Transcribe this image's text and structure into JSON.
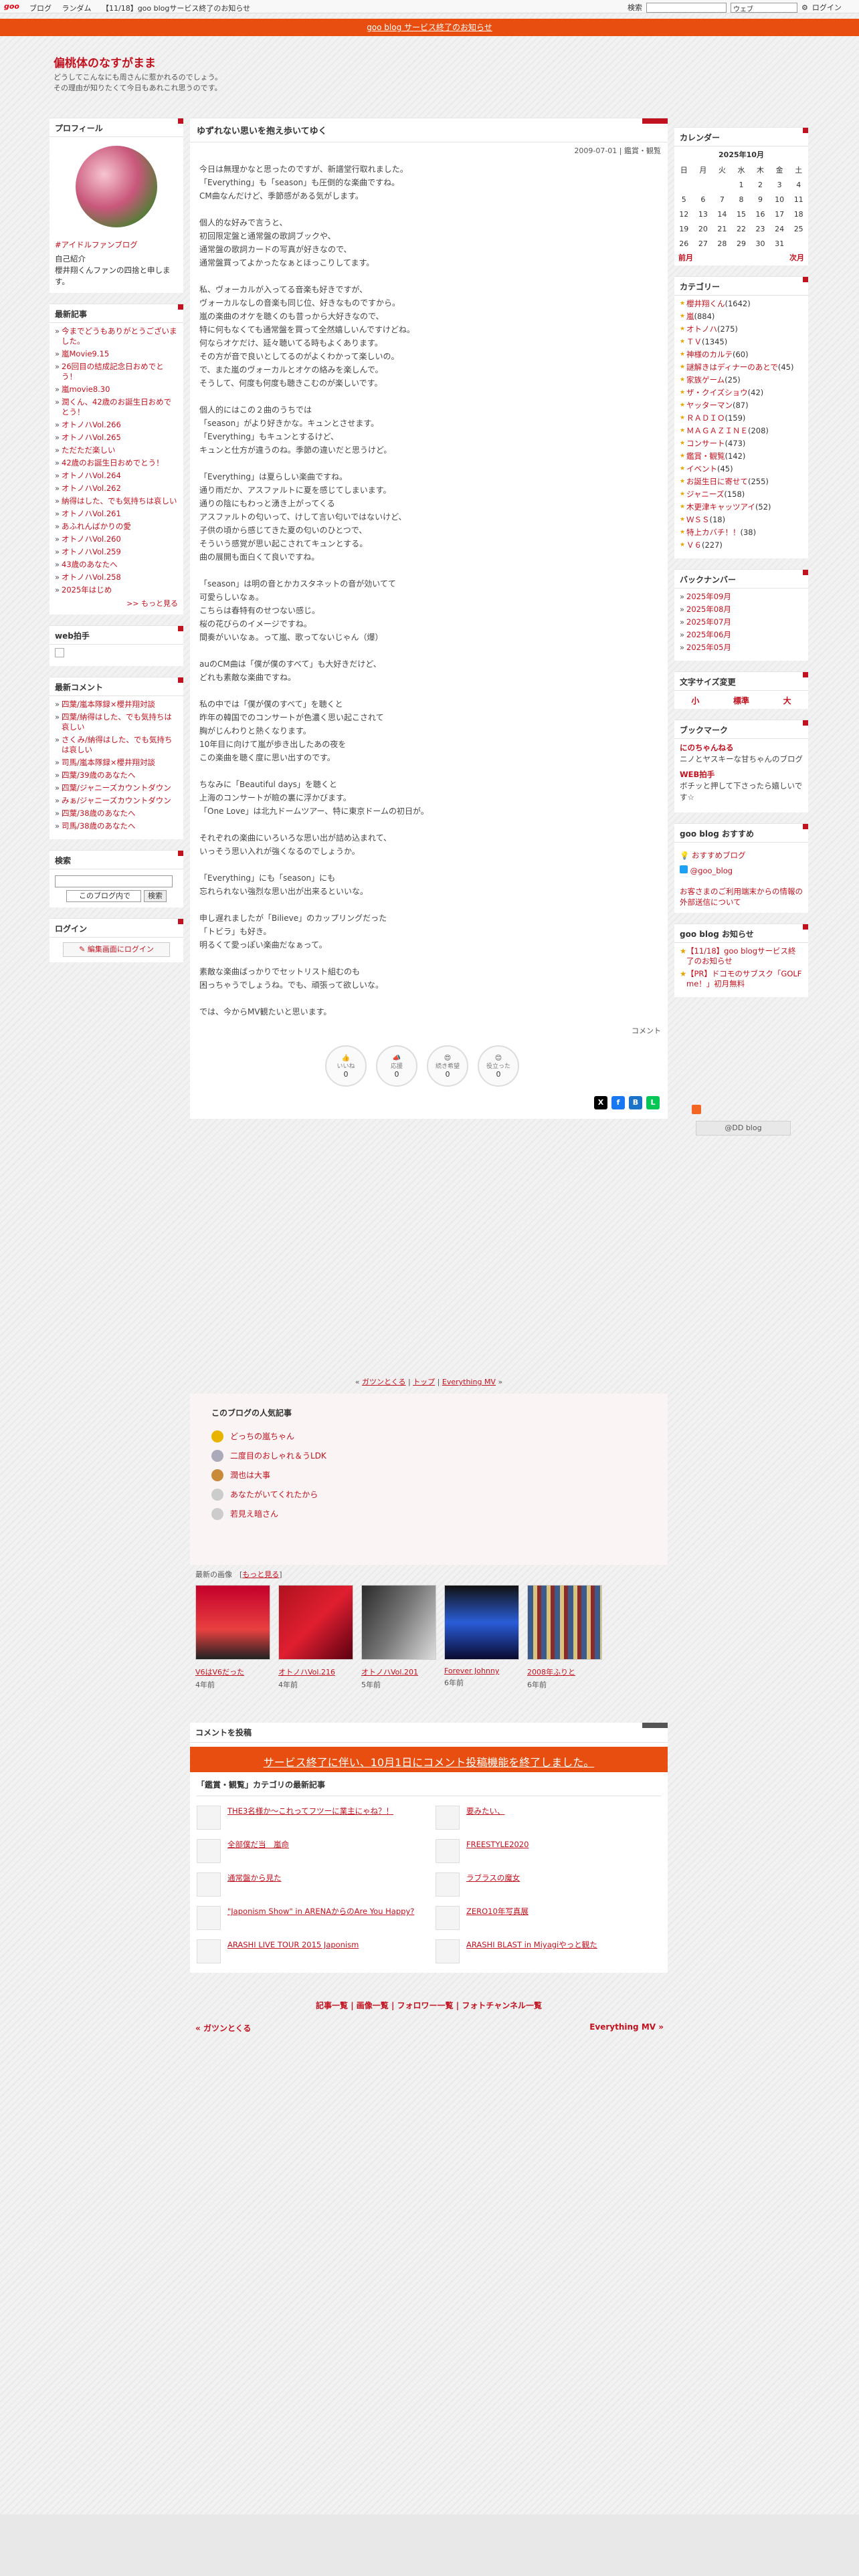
{
  "topbar": {
    "logo": "goo",
    "nav": [
      "ブログ",
      "ランダム",
      "【11/18】goo blogサービス終了のお知らせ"
    ],
    "search_label": "検索",
    "search_scope": "ウェブ",
    "login": "ログイン"
  },
  "notice": "goo blog サービス終了のお知らせ",
  "blog": {
    "title": "偏桃体のなすがまま",
    "desc": [
      "どうしてこんなにも周さんに惹かれるのでしょう。",
      "その理由が知りたくて今日もあれこれ思うのです。"
    ]
  },
  "profile": {
    "heading": "プロフィール",
    "tag": "#アイドルファンブログ",
    "intro_label": "自己紹介",
    "intro": "櫻井翔くんファンの四捨と申します。"
  },
  "recent": {
    "heading": "最新記事",
    "items": [
      "今までどうもありがとうございました。",
      "嵐Movie9.15",
      "26回目の結成記念日おめでとう！",
      "嵐movie8.30",
      "潤くん、42歳のお誕生日おめでとう！",
      "オトノハVol.266",
      "オトノハVol.265",
      "ただただ楽しい",
      "42歳のお誕生日おめでとう！",
      "オトノハVol.264",
      "オトノハVol.262",
      "納得はした、でも気持ちは哀しい",
      "オトノハVol.261",
      "あふれんばかりの愛",
      "オトノハVol.260",
      "オトノハVol.259",
      "43歳のあなたへ",
      "オトノハVol.258",
      "2025年はじめ"
    ],
    "more": ">> もっと見る"
  },
  "web": {
    "heading": "web拍手"
  },
  "comments": {
    "heading": "最新コメント",
    "items": [
      "四葉/嵐本隊録×櫻井翔対談",
      "四葉/納得はした、でも気持ちは哀しい",
      "さくみ/納得はした、でも気持ちは哀しい",
      "司馬/嵐本隊録×櫻井翔対談",
      "四葉/39歳のあなたへ",
      "四葉/ジャニーズカウントダウン",
      "みぁ/ジャニーズカウントダウン",
      "四葉/38歳のあなたへ",
      "司馬/38歳のあなたへ"
    ]
  },
  "search": {
    "heading": "検索",
    "scope": "このブログ内で",
    "button": "検索"
  },
  "login": {
    "heading": "ログイン",
    "button": "編集画面にログイン"
  },
  "article": {
    "title": "ゆずれない思いを抱え歩いてゆく",
    "date": "2009-07-01",
    "category": "鑑賞・観覧",
    "body": "今日は無理かなと思ったのですが、新譜堂行取れました。\n「Everything」も「season」も圧倒的な楽曲ですね。\nCM曲なんだけど、季節感がある気がします。\n\n個人的な好みで言うと、\n初回限定盤と通常盤の歌詞ブックや、\n通常盤の歌詞カードの写真が好きなので、\n通常盤買ってよかったなぁとほっこりしてます。\n\n私、ヴォーカルが入ってる音楽も好きですが、\nヴォーカルなしの音楽も同じ位、好きなものですから。\n嵐の楽曲のオケを聴くのも昔っから大好きなので、\n特に何もなくても通常盤を買って全然嬉しいんですけどね。\n何ならオケだけ、延々聴いてる時もよくあります。\nその方が音で良いとしてるのがよくわかって楽しいの。\nで、また嵐のヴォーカルとオケの絡みを楽しんで。\nそうして、何度も何度も聴きこむのが楽しいです。\n\n個人的にはこの２曲のうちでは\n「season」がより好きかな。キュンとさせます。\n「Everything」もキュンとするけど、\nキュンと仕方が違うのね。季節の違いだと思うけど。\n\n「Everything」は夏らしい楽曲ですね。\n通り雨だか、アスファルトに夏を感じてしまいます。\n通りの陰にもわっと湧き上がってくる\nアスファルトの匂いって、けして言い匂いではないけど、\n子供の頃から感じてきた夏の匂いのひとつで、\nそういう感覚が思い起こされてキュンとする。\n曲の展開も面白くて良いですね。\n\n「season」は明の音とかカスタネットの音が効いてて\n可愛らしいなぁ。\nこちらは春特有のせつない感じ。\n桜の花びらのイメージですね。\n間奏がいいなぁ。って嵐、歌ってないじゃん（爆）\n\nauのCM曲は「僕が僕のすべて」も大好きだけど、\nどれも素敵な楽曲ですね。\n\n私の中では「僕が僕のすべて」を聴くと\n昨年の韓国でのコンサートが色濃く思い起こされて\n胸がじんわりと熱くなります。\n10年目に向けて嵐が歩き出したあの夜を\nこの楽曲を聴く度に思い出すのです。\n\nちなみに「Beautiful days」を聴くと\n上海のコンサートが瞼の裏に浮かびます。\n「One Love」は北九ドームツアー、特に東京ドームの初日が。\n\nそれぞれの楽曲にいろいろな思い出が詰め込まれて、\nいっそう思い入れが強くなるのでしょうか。\n\n「Everything」にも「season」にも\n忘れられない強烈な思い出が出来るといいな。\n\n申し遅れましたが「Bilieve」のカップリングだった\n「トビラ」も好き。\n明るくて愛っぽい楽曲だなぁって。\n\n素敵な楽曲ばっかりでセットリスト組むのも\n困っちゃうでしょうね。でも、頑張って欲しいな。\n\nでは、今からMV観たいと思います。",
    "comment_link": "コメント",
    "reactions": [
      {
        "label": "いいね",
        "count": "0"
      },
      {
        "label": "応援",
        "count": "0"
      },
      {
        "label": "続き希望",
        "count": "0"
      },
      {
        "label": "役立った",
        "count": "0"
      }
    ]
  },
  "pager": {
    "prev": "ガツンとくる",
    "top": "トップ",
    "next": "Everything MV"
  },
  "popular": {
    "heading": "このブログの人気記事",
    "items": [
      "どっちの嵐ちゃん",
      "二度目のおしゃれ＆うLDK",
      "潤也は大事",
      "あなたがいてくれたから",
      "若見え暗さん"
    ]
  },
  "images": {
    "heading": "最新の画像",
    "more": "もっと見る",
    "items": [
      {
        "cap": "V6はV6だった",
        "ago": "4年前"
      },
      {
        "cap": "オトノハVol.216",
        "ago": "4年前"
      },
      {
        "cap": "オトノハVol.201",
        "ago": "5年前"
      },
      {
        "cap": "Forever Johnny",
        "ago": "6年前"
      },
      {
        "cap": "2008年ふりと",
        "ago": "6年前"
      }
    ]
  },
  "post_comment": {
    "heading": "コメントを投稿",
    "banner": "サービス終了に伴い、10月1日にコメント投稿機能を終了しました。"
  },
  "category_latest": {
    "heading": "「鑑賞・観覧」カテゴリの最新記事",
    "items": [
      "THE3名様か〜これってフツーに業主にゃね？！",
      "要みたい、",
      "全部僕だ当　嵐命",
      "FREESTYLE2020",
      "通常盤から見た",
      "ラブラスの魔女",
      "\"Japonism Show\" in ARENAからのAre You Happy?",
      "ZERO10年写真展",
      "ARASHI LIVE TOUR 2015 Japonism",
      "ARASHI BLAST in Miyagiやっと観た"
    ]
  },
  "footer": {
    "links": [
      "記事一覧",
      "画像一覧",
      "フォロワー一覧",
      "フォトチャンネル一覧"
    ],
    "prev": "ガツンとくる",
    "next": "Everything MV"
  },
  "calendar": {
    "heading": "カレンダー",
    "month": "2025年10月",
    "dows": [
      "日",
      "月",
      "火",
      "水",
      "木",
      "金",
      "土"
    ],
    "weeks": [
      [
        "",
        "",
        "",
        "1",
        "2",
        "3",
        "4"
      ],
      [
        "5",
        "6",
        "7",
        "8",
        "9",
        "10",
        "11"
      ],
      [
        "12",
        "13",
        "14",
        "15",
        "16",
        "17",
        "18"
      ],
      [
        "19",
        "20",
        "21",
        "22",
        "23",
        "24",
        "25"
      ],
      [
        "26",
        "27",
        "28",
        "29",
        "30",
        "31",
        ""
      ]
    ],
    "prev": "前月",
    "next": "次月"
  },
  "categories": {
    "heading": "カテゴリー",
    "items": [
      {
        "n": "櫻井翔くん",
        "c": "(1642)"
      },
      {
        "n": "嵐",
        "c": "(884)"
      },
      {
        "n": "オトノハ",
        "c": "(275)"
      },
      {
        "n": "ＴＶ",
        "c": "(1345)"
      },
      {
        "n": "神様のカルテ",
        "c": "(60)"
      },
      {
        "n": "謎解きはディナーのあとで",
        "c": "(45)"
      },
      {
        "n": "家族ゲーム",
        "c": "(25)"
      },
      {
        "n": "ザ・クイズショウ",
        "c": "(42)"
      },
      {
        "n": "ヤッターマン",
        "c": "(87)"
      },
      {
        "n": "ＲＡＤＩＯ",
        "c": "(159)"
      },
      {
        "n": "ＭＡＧＡＺＩＮＥ",
        "c": "(208)"
      },
      {
        "n": "コンサート",
        "c": "(473)"
      },
      {
        "n": "鑑賞・観覧",
        "c": "(142)"
      },
      {
        "n": "イベント",
        "c": "(45)"
      },
      {
        "n": "お誕生日に寄せて",
        "c": "(255)"
      },
      {
        "n": "ジャニーズ",
        "c": "(158)"
      },
      {
        "n": "木更津キャッツアイ",
        "c": "(52)"
      },
      {
        "n": "ＷＳＳ",
        "c": "(18)"
      },
      {
        "n": "特上カバチ！！",
        "c": "(38)"
      },
      {
        "n": "Ｖ６",
        "c": "(227)"
      }
    ]
  },
  "backnumber": {
    "heading": "バックナンバー",
    "items": [
      "2025年09月",
      "2025年08月",
      "2025年07月",
      "2025年06月",
      "2025年05月"
    ]
  },
  "fontsize": {
    "heading": "文字サイズ変更",
    "opts": [
      "小",
      "標準",
      "大"
    ]
  },
  "bookmark": {
    "heading": "ブックマーク",
    "items": [
      {
        "t": "にのちゃんねる",
        "d": "ニノとヤスキーな甘ちゃんのブログ"
      },
      {
        "t": "WEB拍手",
        "d": "ボチッと押して下さったら嬉しいです☆"
      }
    ]
  },
  "goorec": {
    "heading": "goo blog おすすめ",
    "items": [
      "おすすめブログ",
      "@goo_blog"
    ],
    "note": "お客さまのご利用端末からの情報の外部送信について"
  },
  "gooinfo": {
    "heading": "goo blog お知らせ",
    "items": [
      "【11/18】goo blogサービス終了のお知らせ",
      "【PR】ドコモのサブスク「GOLF me！」初月無料"
    ]
  },
  "footer_logo": "@DD blog"
}
